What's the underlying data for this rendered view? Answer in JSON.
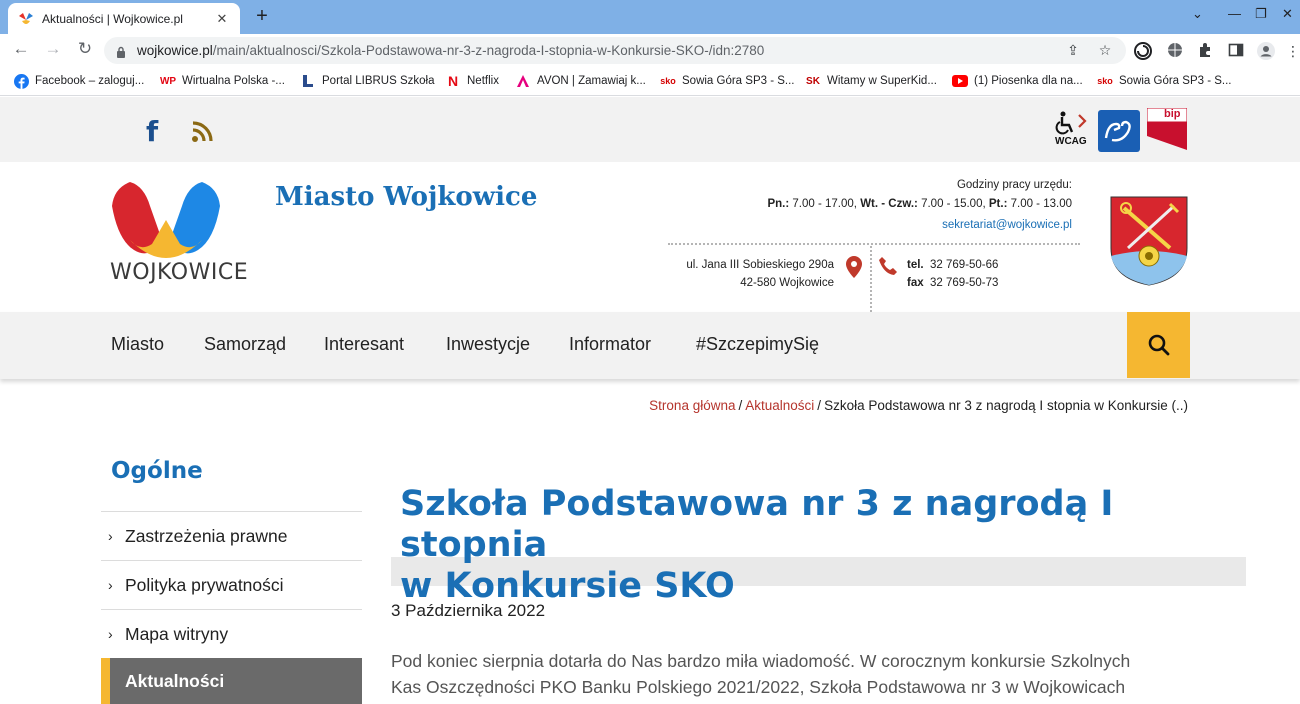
{
  "browser": {
    "tab_title": "Aktualności | Wojkowice.pl",
    "url_domain": "wojkowice.pl",
    "url_path": "/main/aktualnosci/Szkola-Podstawowa-nr-3-z-nagroda-I-stopnia-w-Konkursie-SKO-/idn:2780",
    "bookmarks": [
      {
        "label": "Facebook – zaloguj...",
        "icon": "facebook-icon",
        "color": "#1877f2"
      },
      {
        "label": "Wirtualna Polska -...",
        "icon": "wp-icon",
        "color": "#e30613"
      },
      {
        "label": "Portal LIBRUS Szkoła",
        "icon": "librus-icon",
        "color": "#2b4c8c"
      },
      {
        "label": "Netflix",
        "icon": "netflix-icon",
        "color": "#e50914"
      },
      {
        "label": "AVON | Zamawiaj k...",
        "icon": "avon-icon",
        "color": "#e6007e"
      },
      {
        "label": "Sowia Góra SP3 - S...",
        "icon": "sko-icon",
        "color": "#d40000"
      },
      {
        "label": "Witamy w SuperKid...",
        "icon": "sk-icon",
        "color": "#c00000"
      },
      {
        "label": "(1) Piosenka dla na...",
        "icon": "youtube-icon",
        "color": "#ff0000"
      },
      {
        "label": "Sowia Góra SP3 - S...",
        "icon": "sko-icon",
        "color": "#d40000"
      }
    ]
  },
  "topbar": {
    "wcag_label": "WCAG",
    "bip_label": "bip"
  },
  "header": {
    "logo_text": "WOJKOWICE",
    "city_name": "Miasto Wojkowice",
    "hours_title": "Godziny pracy urzędu:",
    "hours": [
      {
        "day": "Pn.:",
        "time": "7.00 - 17.00,"
      },
      {
        "day": "Wt. - Czw.:",
        "time": "7.00 - 15.00,"
      },
      {
        "day": "Pt.:",
        "time": "7.00 - 13.00"
      }
    ],
    "email": "sekretariat@wojkowice.pl",
    "address_line1": "ul. Jana III Sobieskiego 290a",
    "address_line2": "42-580 Wojkowice",
    "tel_label": "tel.",
    "tel": "32 769-50-66",
    "fax_label": "fax",
    "fax": "32 769-50-73"
  },
  "nav": {
    "items": [
      "Miasto",
      "Samorząd",
      "Interesant",
      "Inwestycje",
      "Informator",
      "#SzczepimySię"
    ]
  },
  "breadcrumb": {
    "home": "Strona główna",
    "section": "Aktualności",
    "current": "Szkoła Podstawowa nr 3 z nagrodą I stopnia w Konkursie (..)"
  },
  "sidebar": {
    "title": "Ogólne",
    "items": [
      "Zastrzeżenia prawne",
      "Polityka prywatności",
      "Mapa witryny"
    ],
    "active": "Aktualności"
  },
  "article": {
    "title_line1": "Szkoła Podstawowa nr 3 z nagrodą I stopnia",
    "title_line2": "w Konkursie SKO",
    "date": "3 Października 2022",
    "body_line1": "Pod koniec sierpnia dotarła do Nas bardzo miła wiadomość. W corocznym konkursie Szkolnych",
    "body_line2": "Kas Oszczędności PKO Banku Polskiego 2021/2022, Szkoła Podstawowa nr 3 w Wojkowicach"
  },
  "colors": {
    "brand_blue": "#1a6fb5",
    "accent_yellow": "#f5b731",
    "breadcrumb_link": "#b5352d",
    "tabbar": "#7fb0e6"
  }
}
